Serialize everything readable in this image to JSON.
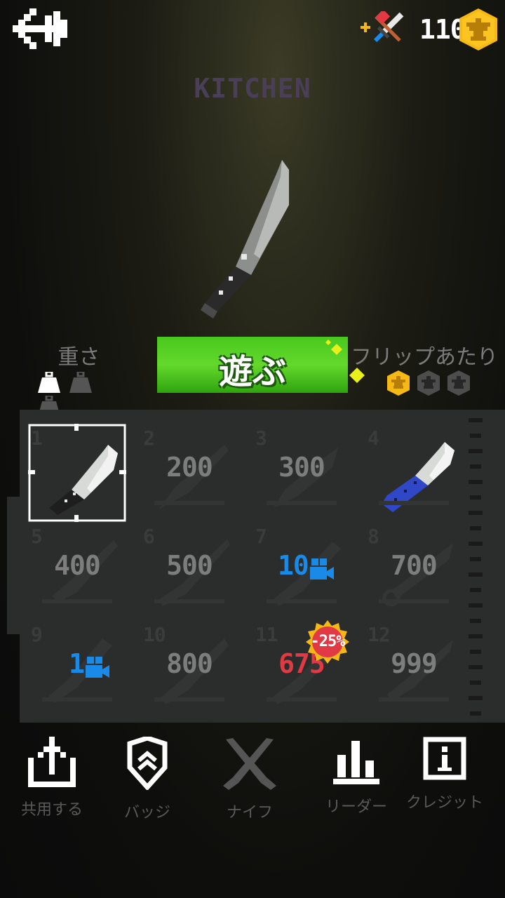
{
  "header": {
    "coins": "110",
    "knife_title": "KITCHEN"
  },
  "play": {
    "label": "遊ぶ"
  },
  "stats": {
    "weight_label": "重さ",
    "weight_level": 1,
    "weight_max": 3,
    "flip_label": "フリップあたり",
    "flip_level": 1,
    "flip_max": 3
  },
  "knives": [
    {
      "num": "1",
      "price": "",
      "type": "owned",
      "selected": true
    },
    {
      "num": "2",
      "price": "200",
      "type": "coins"
    },
    {
      "num": "3",
      "price": "300",
      "type": "coins"
    },
    {
      "num": "4",
      "price": "",
      "type": "owned"
    },
    {
      "num": "5",
      "price": "400",
      "type": "coins"
    },
    {
      "num": "6",
      "price": "500",
      "type": "coins"
    },
    {
      "num": "7",
      "price": "10",
      "type": "video"
    },
    {
      "num": "8",
      "price": "700",
      "type": "coins"
    },
    {
      "num": "9",
      "price": "1",
      "type": "video"
    },
    {
      "num": "10",
      "price": "800",
      "type": "coins"
    },
    {
      "num": "11",
      "price": "675",
      "type": "sale",
      "discount": "-25%"
    },
    {
      "num": "12",
      "price": "999",
      "type": "coins"
    }
  ],
  "nav": {
    "share": "共用する",
    "badges": "バッジ",
    "knives": "ナイフ",
    "leaderboard": "リーダー",
    "credits": "クレジット"
  },
  "colors": {
    "accent_green": "#48c81e",
    "coin_gold": "#f5b814",
    "video_blue": "#1a8ae8",
    "sale_red": "#e23a44",
    "title_purple": "#4a3e58"
  },
  "icons": [
    "back-arrow-icon",
    "sword-axe-plus-icon",
    "eagle-coin-icon",
    "kitchen-knife-icon",
    "weight-icon",
    "share-icon",
    "badge-shield-icon",
    "crossed-knives-icon",
    "leaderboard-icon",
    "info-icon",
    "video-camera-icon"
  ]
}
